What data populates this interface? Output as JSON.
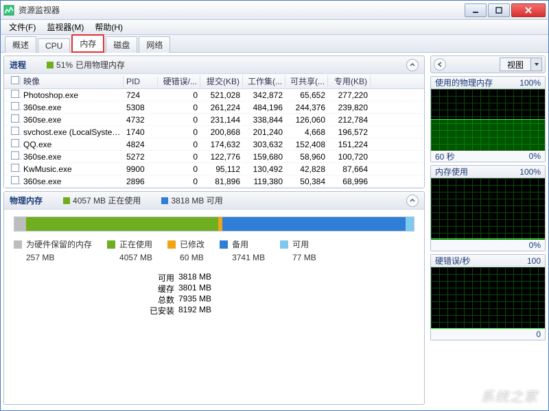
{
  "window": {
    "title": "资源监视器"
  },
  "menu": {
    "file": "文件(F)",
    "monitor": "监视器(M)",
    "help": "帮助(H)"
  },
  "tabs": {
    "overview": "概述",
    "cpu": "CPU",
    "memory": "内存",
    "disk": "磁盘",
    "network": "网络"
  },
  "processes": {
    "title": "进程",
    "usage_pct": "51%",
    "usage_label": "已用物理内存",
    "columns": {
      "image": "映像",
      "pid": "PID",
      "hardfaults": "硬错误/...",
      "commit": "提交(KB)",
      "workingset": "工作集(...",
      "shareable": "可共享(...",
      "private": "专用(KB)"
    },
    "rows": [
      {
        "image": "Photoshop.exe",
        "pid": "724",
        "hf": "0",
        "commit": "521,028",
        "ws": "342,872",
        "sh": "65,652",
        "pv": "277,220"
      },
      {
        "image": "360se.exe",
        "pid": "5308",
        "hf": "0",
        "commit": "261,224",
        "ws": "484,196",
        "sh": "244,376",
        "pv": "239,820"
      },
      {
        "image": "360se.exe",
        "pid": "4732",
        "hf": "0",
        "commit": "231,144",
        "ws": "338,844",
        "sh": "126,060",
        "pv": "212,784"
      },
      {
        "image": "svchost.exe (LocalSystemN...",
        "pid": "1740",
        "hf": "0",
        "commit": "200,868",
        "ws": "201,240",
        "sh": "4,668",
        "pv": "196,572"
      },
      {
        "image": "QQ.exe",
        "pid": "4824",
        "hf": "0",
        "commit": "174,632",
        "ws": "303,632",
        "sh": "152,408",
        "pv": "151,224"
      },
      {
        "image": "360se.exe",
        "pid": "5272",
        "hf": "0",
        "commit": "122,776",
        "ws": "159,680",
        "sh": "58,960",
        "pv": "100,720"
      },
      {
        "image": "KwMusic.exe",
        "pid": "9900",
        "hf": "0",
        "commit": "95,112",
        "ws": "130,492",
        "sh": "42,828",
        "pv": "87,664"
      },
      {
        "image": "360se.exe",
        "pid": "2896",
        "hf": "0",
        "commit": "81,896",
        "ws": "119,380",
        "sh": "50,384",
        "pv": "68,996"
      }
    ]
  },
  "physical": {
    "title": "物理内存",
    "inuse_header": "4057 MB 正在使用",
    "avail_header": "3818 MB 可用",
    "legend": {
      "reserved": {
        "label": "为硬件保留的内存",
        "value": "257 MB",
        "color": "#bdbdbd"
      },
      "inuse": {
        "label": "正在使用",
        "value": "4057 MB",
        "color": "#6FAE1F"
      },
      "modified": {
        "label": "已修改",
        "value": "60 MB",
        "color": "#f1a417"
      },
      "standby": {
        "label": "备用",
        "value": "3741 MB",
        "color": "#2f7ed8"
      },
      "free": {
        "label": "可用",
        "value": "77 MB",
        "color": "#7fc9ef"
      }
    },
    "stats": {
      "available": {
        "label": "可用",
        "value": "3818 MB"
      },
      "cached": {
        "label": "缓存",
        "value": "3801 MB"
      },
      "total": {
        "label": "总数",
        "value": "7935 MB"
      },
      "installed": {
        "label": "已安装",
        "value": "8192 MB"
      }
    }
  },
  "right": {
    "view": "视图",
    "charts": [
      {
        "title": "使用的物理内存",
        "right": "100%",
        "footer_left": "60 秒",
        "footer_right": "0%",
        "fill_pct": 51
      },
      {
        "title": "内存使用",
        "right": "100%",
        "footer_left": "",
        "footer_right": "0%",
        "fill_pct": 2
      },
      {
        "title": "硬错误/秒",
        "right": "100",
        "footer_left": "",
        "footer_right": "0",
        "fill_pct": 0
      }
    ]
  },
  "chart_data": {
    "type": "area",
    "series": [
      {
        "name": "使用的物理内存",
        "unit": "%",
        "range": [
          0,
          100
        ],
        "approx_current": 51
      },
      {
        "name": "内存使用",
        "unit": "%",
        "range": [
          0,
          100
        ],
        "approx_current": 2
      },
      {
        "name": "硬错误/秒",
        "unit": "count",
        "range": [
          0,
          100
        ],
        "approx_current": 0
      }
    ],
    "x_span_seconds": 60
  },
  "watermark": "系统之家"
}
